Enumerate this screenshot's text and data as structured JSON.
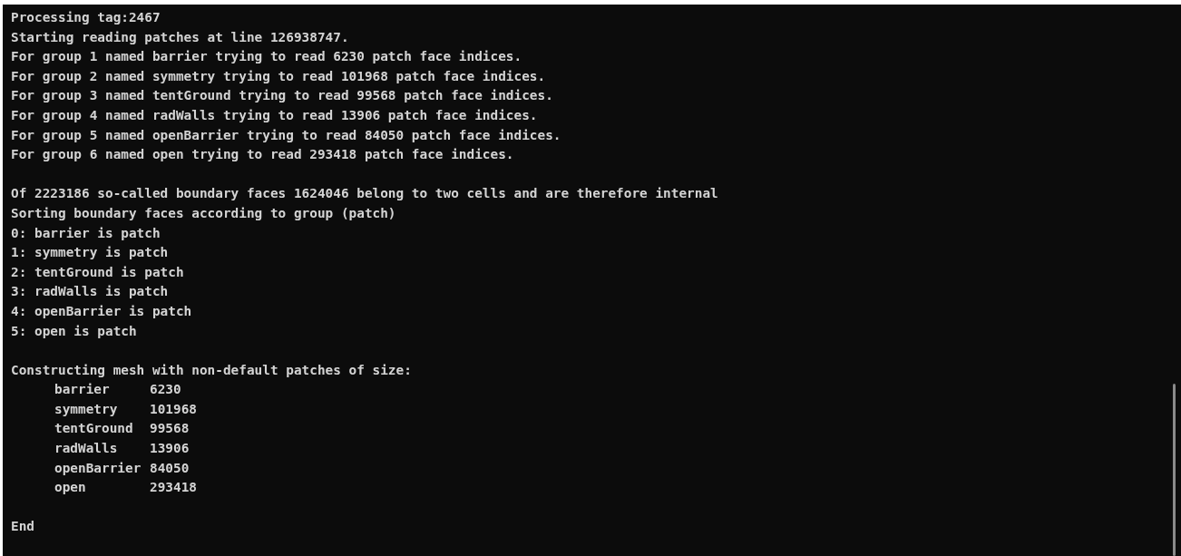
{
  "terminal": {
    "blocks": [
      {
        "lines": [
          "Processing tag:2467",
          "Starting reading patches at line 126938747.",
          "For group 1 named barrier trying to read 6230 patch face indices.",
          "For group 2 named symmetry trying to read 101968 patch face indices.",
          "For group 3 named tentGround trying to read 99568 patch face indices.",
          "For group 4 named radWalls trying to read 13906 patch face indices.",
          "For group 5 named openBarrier trying to read 84050 patch face indices.",
          "For group 6 named open trying to read 293418 patch face indices."
        ]
      },
      {
        "lines": [
          "Of 2223186 so-called boundary faces 1624046 belong to two cells and are therefore internal",
          "Sorting boundary faces according to group (patch)",
          "0: barrier is patch",
          "1: symmetry is patch",
          "2: tentGround is patch",
          "3: radWalls is patch",
          "4: openBarrier is patch",
          "5: open is patch"
        ]
      },
      {
        "lines": [
          "Constructing mesh with non-default patches of size:"
        ],
        "rows": [
          {
            "name": "barrier",
            "size": "6230"
          },
          {
            "name": "symmetry",
            "size": "101968"
          },
          {
            "name": "tentGround",
            "size": "99568"
          },
          {
            "name": "radWalls",
            "size": "13906"
          },
          {
            "name": "openBarrier",
            "size": "84050"
          },
          {
            "name": "open",
            "size": "293418"
          }
        ]
      },
      {
        "lines": [
          "End"
        ]
      }
    ]
  }
}
